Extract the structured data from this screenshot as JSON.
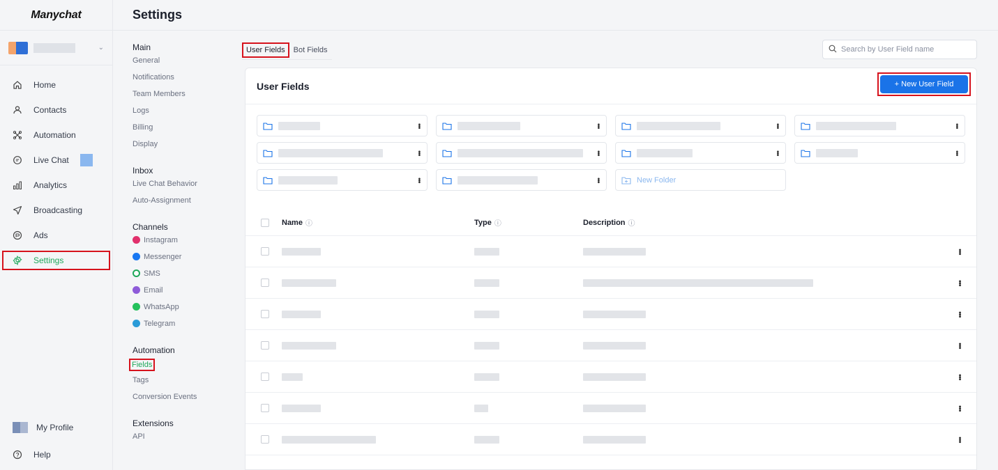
{
  "app": {
    "logo": "Manychat"
  },
  "nav": {
    "items": [
      {
        "label": "Home",
        "icon": "home-icon"
      },
      {
        "label": "Contacts",
        "icon": "user-icon"
      },
      {
        "label": "Automation",
        "icon": "automation-icon"
      },
      {
        "label": "Live Chat",
        "icon": "chat-icon"
      },
      {
        "label": "Analytics",
        "icon": "analytics-icon"
      },
      {
        "label": "Broadcasting",
        "icon": "send-icon"
      },
      {
        "label": "Ads",
        "icon": "ads-icon"
      },
      {
        "label": "Settings",
        "icon": "settings-icon",
        "active": true
      }
    ],
    "bottom": [
      {
        "label": "My Profile"
      },
      {
        "label": "Help",
        "icon": "help-icon"
      }
    ]
  },
  "header": {
    "title": "Settings"
  },
  "subnav": {
    "main": {
      "title": "Main",
      "items": [
        "General",
        "Notifications",
        "Team Members",
        "Logs",
        "Billing",
        "Display"
      ]
    },
    "inbox": {
      "title": "Inbox",
      "items": [
        "Live Chat Behavior",
        "Auto-Assignment"
      ]
    },
    "channels": {
      "title": "Channels",
      "items": [
        {
          "label": "Instagram",
          "color": "#e1306c"
        },
        {
          "label": "Messenger",
          "color": "#1877f2"
        },
        {
          "label": "SMS",
          "color": "#20a85b"
        },
        {
          "label": "Email",
          "color": "#8e5bd9"
        },
        {
          "label": "WhatsApp",
          "color": "#25c15c"
        },
        {
          "label": "Telegram",
          "color": "#2a9bd8"
        }
      ]
    },
    "automation": {
      "title": "Automation",
      "items": [
        "Fields",
        "Tags",
        "Conversion Events"
      ]
    },
    "extensions": {
      "title": "Extensions",
      "items": [
        "API"
      ]
    }
  },
  "tabs": [
    "User Fields",
    "Bot Fields"
  ],
  "search": {
    "placeholder": "Search by User Field name"
  },
  "card": {
    "title": "User Fields",
    "new_button": "+ New User Field",
    "new_folder": "New Folder"
  },
  "table": {
    "headers": {
      "name": "Name",
      "type": "Type",
      "description": "Description"
    }
  },
  "colors": {
    "accent": "#1a73e8",
    "active": "#20a85b",
    "highlight": "#d6121c"
  }
}
